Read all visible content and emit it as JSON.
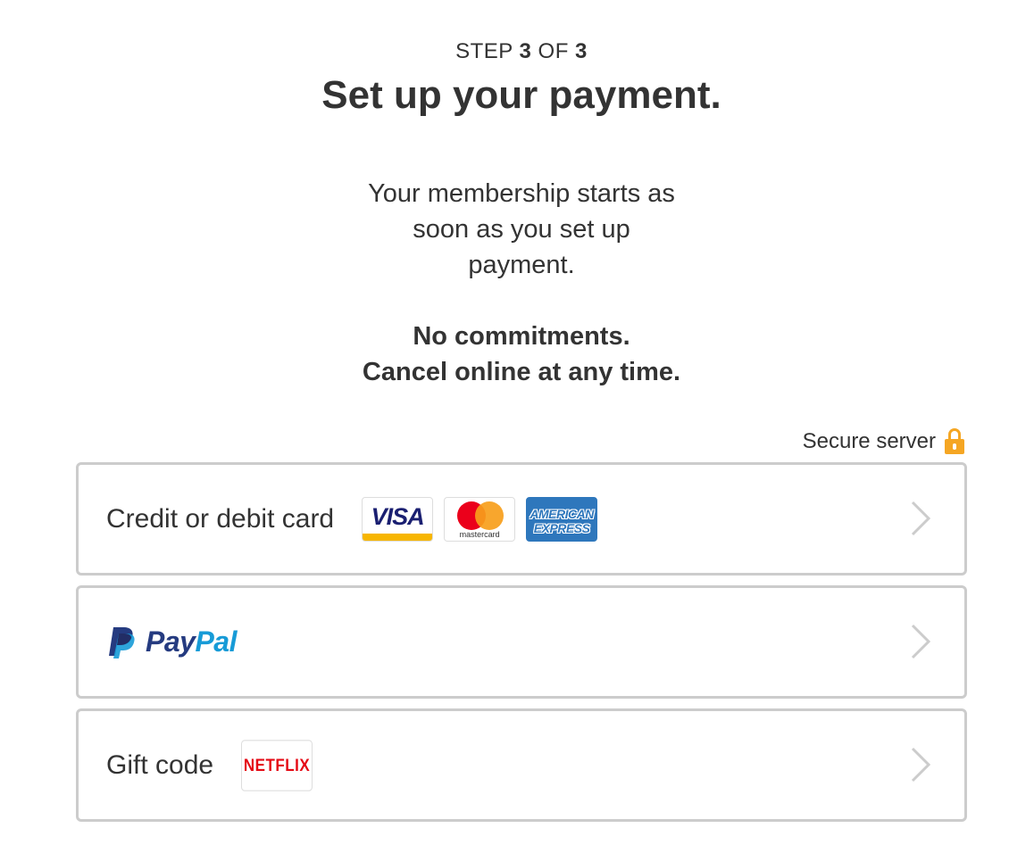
{
  "header": {
    "step_prefix": "STEP",
    "step_current": "3",
    "step_of": "OF",
    "step_total": "3",
    "title": "Set up your payment."
  },
  "intro": {
    "membership_lines": [
      "Your membership starts as",
      "soon as you set up",
      "payment."
    ],
    "commitment_lines": [
      "No commitments.",
      "Cancel online at any time."
    ]
  },
  "secure": {
    "label": "Secure server",
    "icon": "lock-icon",
    "icon_color": "#f5a623"
  },
  "options": {
    "card": {
      "label": "Credit or debit card",
      "logos": {
        "visa": "VISA",
        "mastercard": "mastercard",
        "amex_line1": "AMERICAN",
        "amex_line2": "EXPRESS"
      }
    },
    "paypal": {
      "word_pay": "Pay",
      "word_pal": "Pal"
    },
    "gift": {
      "label": "Gift code",
      "logo": "NETFLIX"
    }
  },
  "colors": {
    "border": "#cccccc",
    "text": "#333333",
    "netflix_red": "#e50914",
    "paypal_dark": "#253b80",
    "paypal_light": "#179bd7"
  }
}
